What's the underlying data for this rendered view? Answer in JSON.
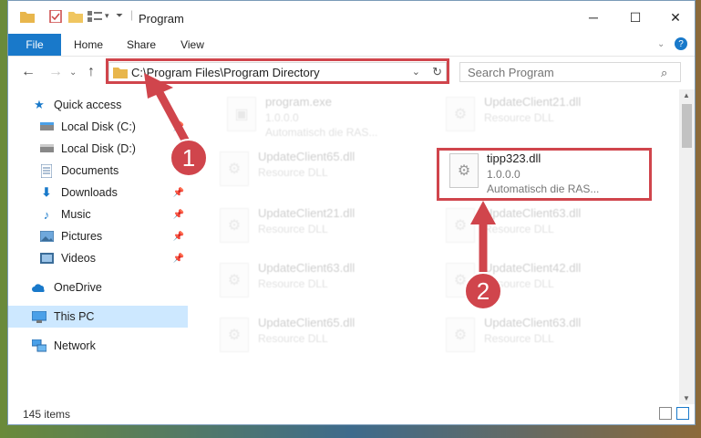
{
  "window": {
    "title": "Program",
    "controls": {
      "minimize": "─",
      "maximize": "☐",
      "close": "✕"
    }
  },
  "ribbon": {
    "tabs": [
      {
        "label": "File",
        "active": true
      },
      {
        "label": "Home"
      },
      {
        "label": "Share"
      },
      {
        "label": "View"
      }
    ],
    "help": "?"
  },
  "address": {
    "path": "C:\\Program Files\\Program Directory",
    "search_placeholder": "Search Program"
  },
  "sidebar": {
    "items": [
      {
        "label": "Quick access",
        "icon": "star-icon"
      },
      {
        "label": "Local Disk (C:)",
        "icon": "drive-icon"
      },
      {
        "label": "Local Disk (D:)",
        "icon": "drive-icon"
      },
      {
        "label": "Documents",
        "icon": "documents-icon"
      },
      {
        "label": "Downloads",
        "icon": "downloads-icon"
      },
      {
        "label": "Music",
        "icon": "music-icon"
      },
      {
        "label": "Pictures",
        "icon": "pictures-icon"
      },
      {
        "label": "Videos",
        "icon": "videos-icon"
      },
      {
        "label": "OneDrive",
        "icon": "cloud-icon"
      },
      {
        "label": "This PC",
        "icon": "computer-icon"
      },
      {
        "label": "Network",
        "icon": "network-icon"
      }
    ]
  },
  "files": [
    {
      "name": "program.exe",
      "line1": "1.0.0.0",
      "line2": "Automatisch die RAS..."
    },
    {
      "name": "UpdateClient21.dll",
      "line1": "Resource DLL"
    },
    {
      "name": "UpdateClient65.dll",
      "line1": "Resource DLL"
    },
    {
      "name": "tipp323.dll",
      "line1": "1.0.0.0",
      "line2": "Automatisch die RAS..."
    },
    {
      "name": "UpdateClient21.dll",
      "line1": "Resource DLL"
    },
    {
      "name": "UpdateClient63.dll",
      "line1": "Resource DLL"
    },
    {
      "name": "UpdateClient63.dll",
      "line1": "Resource DLL"
    },
    {
      "name": "UpdateClient42.dll",
      "line1": "Resource DLL"
    },
    {
      "name": "UpdateClient65.dll",
      "line1": "Resource DLL"
    },
    {
      "name": "UpdateClient63.dll",
      "line1": "Resource DLL"
    }
  ],
  "status": {
    "count": "145 items"
  },
  "annotations": {
    "step1": "1",
    "step2": "2"
  },
  "colors": {
    "accent": "#1979ca",
    "highlight": "#d0454c"
  }
}
